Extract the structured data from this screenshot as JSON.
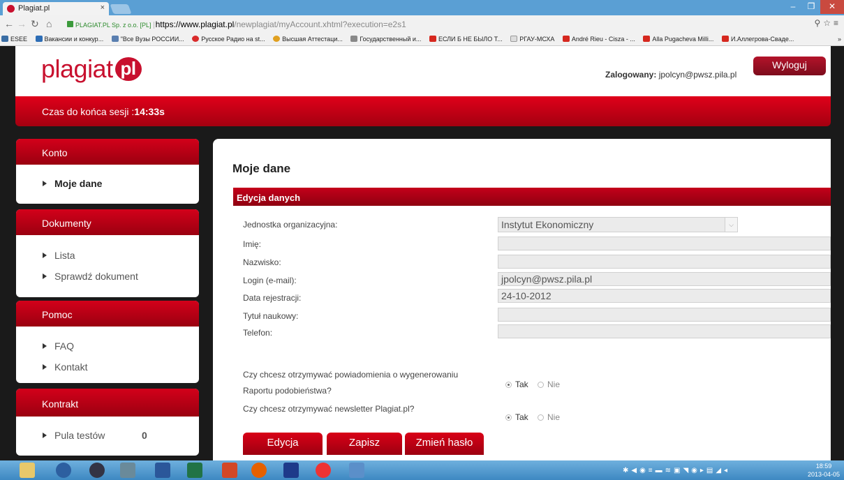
{
  "browser": {
    "tab_title": "Plagiat.pl",
    "tab_close": "×",
    "ev_label": "PLAGIAT.PL Sp. z o.o. [PL]",
    "url_host": "https://www.plagiat.pl",
    "url_path": "/newplagiat/myAccount.xhtml?execution=e2s1",
    "bookmarks": [
      "ESEE",
      "Вакансии и конкур...",
      "\"Все Вузы РОССИИ...",
      "Русское Радио на st...",
      "Высшая Аттестаци...",
      "Государственный и...",
      "ЕСЛИ Б НЕ БЫЛО Т...",
      "РГАУ-МСХА",
      "André Rieu - Cisza - ...",
      "Alla Pugacheva Milli...",
      "И.Аллегрова-Сваде..."
    ],
    "bookmark_more": "»"
  },
  "header": {
    "logo_text": "plagiat",
    "logo_badge": "pl",
    "login_label": "Zalogowany:",
    "login_user": "jpolcyn@pwsz.pila.pl",
    "logout_label": "Wyloguj"
  },
  "session": {
    "label": "Czas do końca sesji :",
    "time": "14:33s"
  },
  "sidebar": {
    "konto": {
      "title": "Konto",
      "items": [
        "Moje dane"
      ]
    },
    "dokumenty": {
      "title": "Dokumenty",
      "items": [
        "Lista",
        "Sprawdź dokument"
      ]
    },
    "pomoc": {
      "title": "Pomoc",
      "items": [
        "FAQ",
        "Kontakt"
      ]
    },
    "kontrakt": {
      "title": "Kontrakt",
      "item_label": "Pula testów",
      "item_count": "0"
    }
  },
  "main": {
    "title": "Moje dane",
    "section_title": "Edycja danych",
    "fields": {
      "unit": {
        "label": "Jednostka organizacyjna:",
        "value": "Instytut Ekonomiczny"
      },
      "first_name": {
        "label": "Imię:",
        "value": ""
      },
      "last_name": {
        "label": "Nazwisko:",
        "value": ""
      },
      "login": {
        "label": "Login (e-mail):",
        "value": "jpolcyn@pwsz.pila.pl"
      },
      "reg_date": {
        "label": "Data rejestracji:",
        "value": "24-10-2012"
      },
      "title": {
        "label": "Tytuł naukowy:",
        "value": ""
      },
      "phone": {
        "label": "Telefon:",
        "value": ""
      }
    },
    "q1": {
      "line1": "Czy chcesz otrzymywać powiadomienia o wygenerowaniu",
      "line2": "Raportu podobieństwa?",
      "yes": "Tak",
      "no": "Nie",
      "selected": "Tak"
    },
    "q2": {
      "text": "Czy chcesz otrzymywać newsletter Plagiat.pl?",
      "yes": "Tak",
      "no": "Nie",
      "selected": "Tak"
    },
    "buttons": {
      "edit": "Edycja",
      "save": "Zapisz",
      "change_password": "Zmień hasło"
    }
  },
  "taskbar": {
    "time": "18:59",
    "date": "2013-04-05"
  },
  "colors": {
    "brand_red": "#c8102e",
    "taskbar_blue": "#3d88c2"
  }
}
